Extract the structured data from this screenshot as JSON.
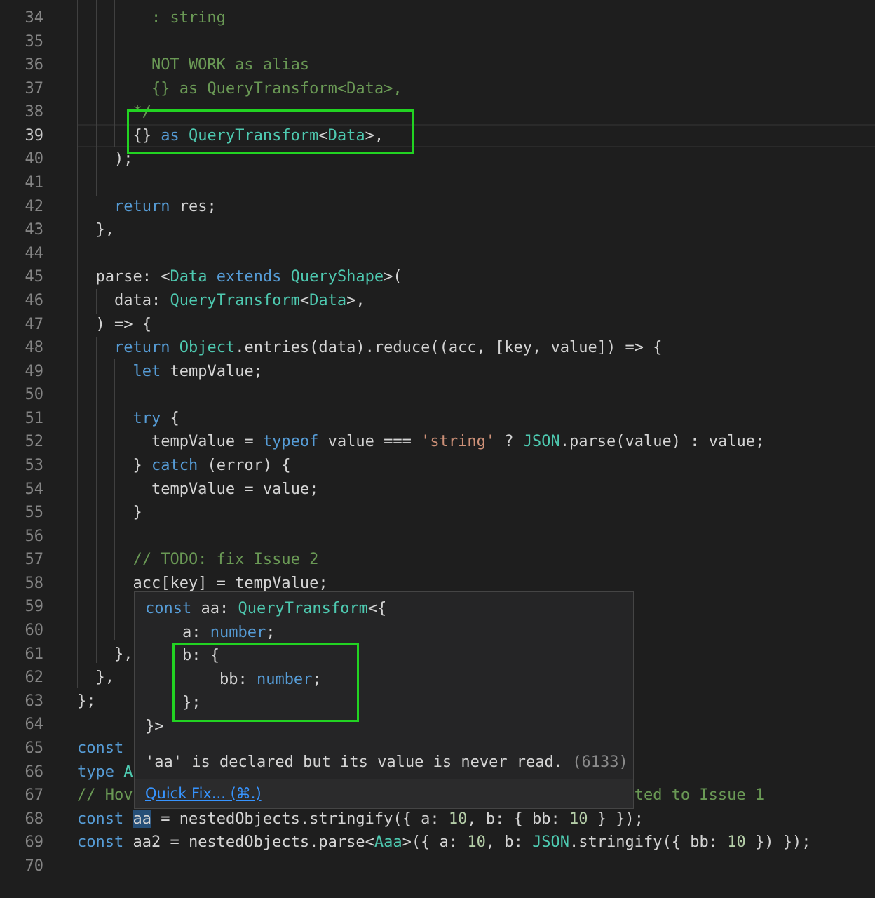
{
  "editor": {
    "current_line": 39,
    "lines": [
      {
        "n": 34,
        "t": [
          [
            "        : string",
            "cm"
          ]
        ]
      },
      {
        "n": 35,
        "t": []
      },
      {
        "n": 36,
        "t": [
          [
            "        NOT WORK as alias",
            "cm"
          ]
        ]
      },
      {
        "n": 37,
        "t": [
          [
            "        {} as QueryTransform<Data>,",
            "cm"
          ]
        ]
      },
      {
        "n": 38,
        "t": [
          [
            "      */",
            "cm"
          ]
        ]
      },
      {
        "n": 39,
        "t": [
          [
            "      {} ",
            ""
          ],
          [
            "as",
            "kw"
          ],
          [
            " ",
            ""
          ],
          [
            "QueryTransform",
            "ty"
          ],
          [
            "<",
            ""
          ],
          [
            "Data",
            "ty"
          ],
          [
            ">,",
            ""
          ]
        ]
      },
      {
        "n": 40,
        "t": [
          [
            "    );",
            ""
          ]
        ]
      },
      {
        "n": 41,
        "t": []
      },
      {
        "n": 42,
        "t": [
          [
            "    ",
            ""
          ],
          [
            "return",
            "kw"
          ],
          [
            " res;",
            ""
          ]
        ]
      },
      {
        "n": 43,
        "t": [
          [
            "  },",
            ""
          ]
        ]
      },
      {
        "n": 44,
        "t": []
      },
      {
        "n": 45,
        "t": [
          [
            "  parse: <",
            ""
          ],
          [
            "Data",
            "ty"
          ],
          [
            " ",
            ""
          ],
          [
            "extends",
            "kw"
          ],
          [
            " ",
            ""
          ],
          [
            "QueryShape",
            "ty"
          ],
          [
            ">(",
            ""
          ]
        ]
      },
      {
        "n": 46,
        "t": [
          [
            "    data: ",
            ""
          ],
          [
            "QueryTransform",
            "ty"
          ],
          [
            "<",
            ""
          ],
          [
            "Data",
            "ty"
          ],
          [
            ">,",
            ""
          ]
        ]
      },
      {
        "n": 47,
        "t": [
          [
            "  ) => {",
            ""
          ]
        ]
      },
      {
        "n": 48,
        "t": [
          [
            "    ",
            ""
          ],
          [
            "return",
            "kw"
          ],
          [
            " ",
            ""
          ],
          [
            "Object",
            "ty"
          ],
          [
            ".entries(data).reduce((acc, [key, value]) => {",
            ""
          ]
        ]
      },
      {
        "n": 49,
        "t": [
          [
            "      ",
            ""
          ],
          [
            "let",
            "kw"
          ],
          [
            " tempValue;",
            ""
          ]
        ]
      },
      {
        "n": 50,
        "t": []
      },
      {
        "n": 51,
        "t": [
          [
            "      ",
            ""
          ],
          [
            "try",
            "kw"
          ],
          [
            " {",
            ""
          ]
        ]
      },
      {
        "n": 52,
        "t": [
          [
            "        tempValue = ",
            ""
          ],
          [
            "typeof",
            "kw"
          ],
          [
            " value === ",
            ""
          ],
          [
            "'string'",
            "st"
          ],
          [
            " ? ",
            ""
          ],
          [
            "JSON",
            "ty"
          ],
          [
            ".parse(value) : value;",
            ""
          ]
        ]
      },
      {
        "n": 53,
        "t": [
          [
            "      } ",
            ""
          ],
          [
            "catch",
            "kw"
          ],
          [
            " (error) {",
            ""
          ]
        ]
      },
      {
        "n": 54,
        "t": [
          [
            "        tempValue = value;",
            ""
          ]
        ]
      },
      {
        "n": 55,
        "t": [
          [
            "      }",
            ""
          ]
        ]
      },
      {
        "n": 56,
        "t": []
      },
      {
        "n": 57,
        "t": [
          [
            "      // TODO: fix Issue 2",
            "cm"
          ]
        ]
      },
      {
        "n": 58,
        "t": [
          [
            "      acc[key] = tempValue;",
            ""
          ]
        ]
      },
      {
        "n": 59,
        "t": []
      },
      {
        "n": 60,
        "t": []
      },
      {
        "n": 61,
        "t": [
          [
            "    },",
            ""
          ]
        ]
      },
      {
        "n": 62,
        "t": [
          [
            "  },",
            ""
          ]
        ]
      },
      {
        "n": 63,
        "t": [
          [
            "};",
            ""
          ]
        ]
      },
      {
        "n": 64,
        "t": []
      },
      {
        "n": 65,
        "t": [
          [
            "const",
            "kw"
          ]
        ]
      },
      {
        "n": 66,
        "t": [
          [
            "type",
            "kw"
          ],
          [
            " ",
            ""
          ],
          [
            "A",
            "ty"
          ]
        ]
      },
      {
        "n": 67,
        "t": [
          [
            "// Hov                                                      ted to Issue 1",
            "cm"
          ]
        ]
      },
      {
        "n": 68,
        "t": [
          [
            "const",
            "kw"
          ],
          [
            " ",
            ""
          ],
          [
            "aa",
            "sel"
          ],
          [
            " = nestedObjects.stringify({ a: ",
            ""
          ],
          [
            "10",
            "nu"
          ],
          [
            ", b: { bb: ",
            ""
          ],
          [
            "10",
            "nu"
          ],
          [
            " } });",
            ""
          ]
        ]
      },
      {
        "n": 69,
        "t": [
          [
            "const",
            "kw"
          ],
          [
            " aa2 = nestedObjects.parse<",
            ""
          ],
          [
            "Aaa",
            "ty"
          ],
          [
            ">({ a: ",
            ""
          ],
          [
            "10",
            "nu"
          ],
          [
            ", b: ",
            ""
          ],
          [
            "JSON",
            "ty"
          ],
          [
            ".stringify({ bb: ",
            ""
          ],
          [
            "10",
            "nu"
          ],
          [
            " }) });",
            ""
          ]
        ]
      },
      {
        "n": 70,
        "t": []
      }
    ]
  },
  "hover": {
    "signature": [
      [
        [
          "const",
          "kw"
        ],
        [
          " aa: ",
          ""
        ],
        [
          "QueryTransform",
          "ty"
        ],
        [
          "<{",
          ""
        ]
      ],
      [
        [
          "    a: ",
          ""
        ],
        [
          "number",
          "kw"
        ],
        [
          ";",
          ""
        ]
      ],
      [
        [
          "    b: {",
          ""
        ]
      ],
      [
        [
          "        bb: ",
          ""
        ],
        [
          "number",
          "kw"
        ],
        [
          ";",
          ""
        ]
      ],
      [
        [
          "    };",
          ""
        ]
      ],
      [
        [
          "}>",
          ""
        ]
      ]
    ],
    "message": "'aa' is declared but its value is never read.",
    "error_code": "(6133)",
    "quick_fix_label": "Quick Fix... (⌘.)"
  },
  "annotations": {
    "highlight_color": "#22d322"
  },
  "theme": {
    "background": "#1e1e1e",
    "keyword": "#569cd6",
    "type": "#4ec9b0",
    "comment": "#6a9955",
    "string": "#ce9178",
    "number": "#b5cea8"
  }
}
